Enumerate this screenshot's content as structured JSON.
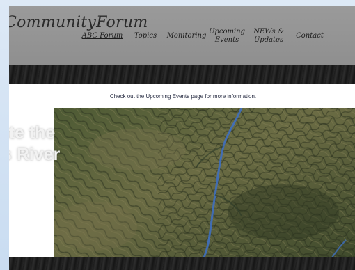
{
  "header": {
    "logo": "CommunityForum",
    "nav": [
      {
        "line1": "ABC Forum",
        "line2": "",
        "active": true
      },
      {
        "line1": "Topics",
        "line2": ""
      },
      {
        "line1": "Monitoring",
        "line2": ""
      },
      {
        "line1": "Upcoming",
        "line2": "Events"
      },
      {
        "line1": "NEWs &",
        "line2": "Updates"
      },
      {
        "line1": "Contact",
        "line2": ""
      }
    ]
  },
  "notice": {
    "text": "Check out the Upcoming Events page for more information."
  },
  "hero": {
    "title_line1": "rate the",
    "title_line2": "as River"
  },
  "colors": {
    "header_bg": "#9a9a9a",
    "band": "#1f1f1f",
    "notice_text": "#2a2f45",
    "river": "#3f6fbf",
    "terrain": "#5b6b3a"
  }
}
